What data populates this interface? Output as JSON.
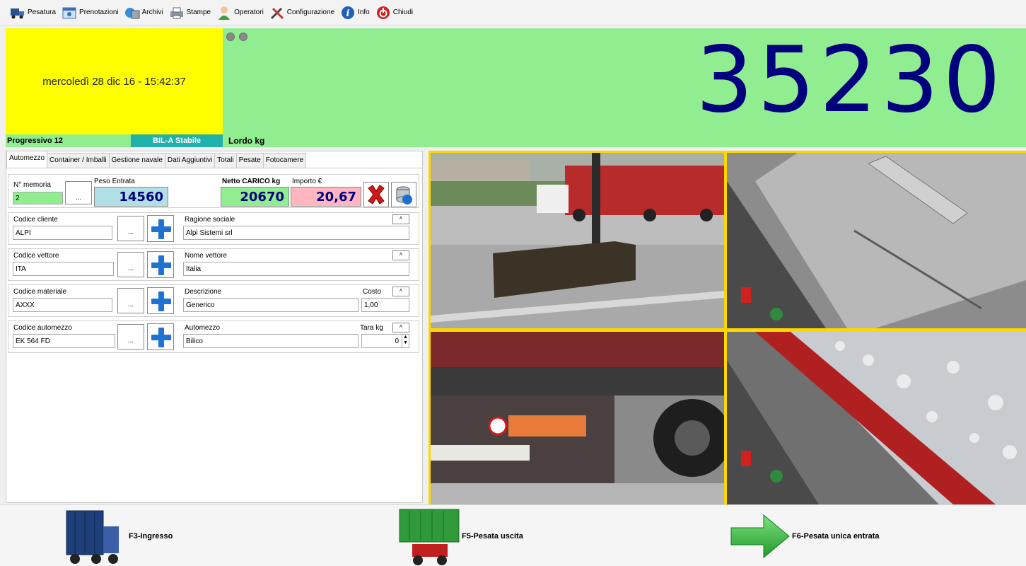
{
  "toolbar": {
    "items": [
      {
        "label": "Pesatura",
        "icon": "truck-scale-icon"
      },
      {
        "label": "Prenotazioni",
        "icon": "calendar-icon"
      },
      {
        "label": "Archivi",
        "icon": "archive-icon"
      },
      {
        "label": "Stampe",
        "icon": "printer-icon"
      },
      {
        "label": "Operatori",
        "icon": "user-icon"
      },
      {
        "label": "Configurazione",
        "icon": "tools-icon"
      },
      {
        "label": "Info",
        "icon": "info-icon"
      },
      {
        "label": "Chiudi",
        "icon": "close-icon"
      }
    ]
  },
  "header": {
    "datetime": "mercoledì 28 dic 16 - 15:42:37",
    "weight": "35230",
    "progressivo": "Progressivo 12",
    "bil_status": "BIL-A Stabile",
    "lordo": "Lordo kg"
  },
  "tabs": [
    "Automezzo",
    "Container / Imballi",
    "Gestione navale",
    "Dati Aggiuntivi",
    "Totali",
    "Pesate",
    "Fotocamere"
  ],
  "form": {
    "memoria_label": "N° memoria",
    "memoria_value": "2",
    "dots": "...",
    "peso_entrata_label": "Peso Entrata",
    "peso_entrata_value": "14560",
    "netto_label": "Netto CARICO kg",
    "netto_value": "20670",
    "importo_label": "Importo  €",
    "importo_value": "20,67",
    "codice_cliente_label": "Codice cliente",
    "codice_cliente_value": "ALPI",
    "ragione_sociale_label": "Ragione sociale",
    "ragione_sociale_value": "Alpi Sistemi srl",
    "codice_vettore_label": "Codice vettore",
    "codice_vettore_value": "ITA",
    "nome_vettore_label": "Nome vettore",
    "nome_vettore_value": "Italia",
    "codice_materiale_label": "Codice materiale",
    "codice_materiale_value": "AXXX",
    "descrizione_label": "Descrizione",
    "descrizione_value": "Generico",
    "costo_label": "Costo",
    "costo_value": "1,00",
    "codice_automezzo_label": "Codice automezzo",
    "codice_automezzo_value": "EK 564 FD",
    "automezzo_label": "Automezzo",
    "automezzo_value": "Bilico",
    "tara_label": "Tara kg",
    "tara_value": "0",
    "mini": "˄"
  },
  "bottom": {
    "f3": "F3-Ingresso",
    "f5": "F5-Pesata uscita",
    "f6": "F6-Pesata unica entrata"
  },
  "colors": {
    "yellow": "#ffff00",
    "green": "#90ee90",
    "teal": "#20b2aa",
    "weight_text": "#00007f",
    "camera_border": "#ffd700"
  }
}
